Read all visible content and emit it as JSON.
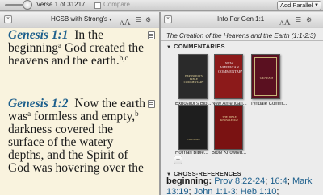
{
  "toolbar": {
    "verse_label": "Verse 1 of 31217",
    "compare_label": "Compare",
    "add_parallel_label": "Add Parallel"
  },
  "left_panel": {
    "title": "HCSB with Strong's",
    "font_small": "A",
    "font_large": "A",
    "verses": [
      {
        "ref": "Genesis 1:1",
        "text": "In the beginning",
        "sup1": "a",
        "text2": " God created the heavens and the earth.",
        "sup2": "b,c"
      },
      {
        "ref": "Genesis 1:2",
        "text": "Now the earth was",
        "sup1": "a",
        "text2": " formless and empty,",
        "sup2": "b",
        "text3": " darkness covered the surface of the watery depths, and the Spirit of God was hovering over the"
      }
    ]
  },
  "right_panel": {
    "title": "Info For Gen 1:1",
    "font_small": "A",
    "font_large": "A",
    "passage_title": "The Creation of the Heavens and the Earth (1:1-2:3)",
    "commentaries_heading": "COMMENTARIES",
    "books": [
      {
        "label": "Expositor's Bib...",
        "spine": "EXPOSITOR'S BIBLE COMMENTARY",
        "color": "#2a2a2a"
      },
      {
        "label": "New American...",
        "spine": "NEW AMERICAN COMMENTARY",
        "color": "#8c1a1a"
      },
      {
        "label": "Tyndale Comm...",
        "spine": "GENESIS",
        "color": "#5a1020"
      },
      {
        "label": "Holman Bible...",
        "spine": "HOLMAN",
        "color": "#1e1e1e"
      },
      {
        "label": "Bible Knowled...",
        "spine": "THE BIBLE KNOWLEDGE",
        "color": "#7a1212"
      }
    ],
    "crossref_heading": "CROSS-REFERENCES",
    "crossref_lead": "beginning:",
    "crossrefs": [
      "Prov 8:22-24",
      "16:4",
      "Mark 13:19",
      "John 1:1-3",
      "Heb 1:10"
    ]
  }
}
